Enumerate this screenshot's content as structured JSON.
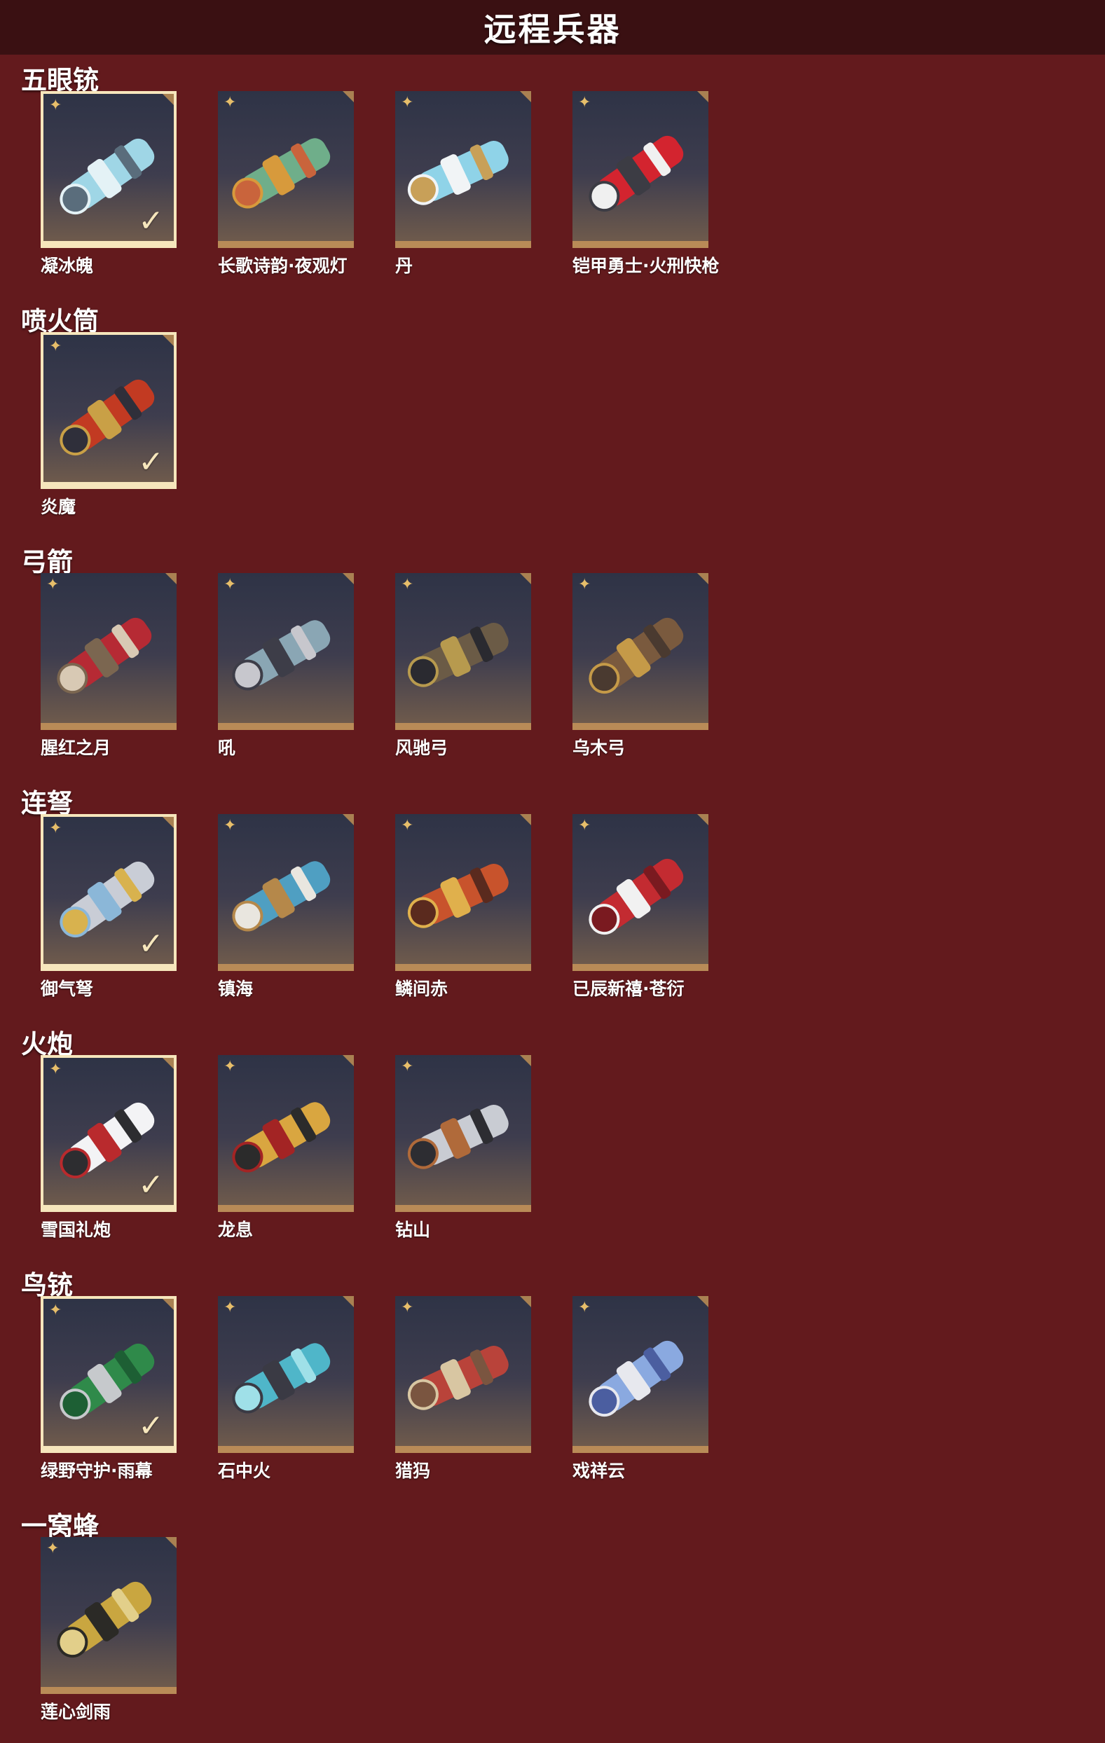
{
  "header": {
    "title": "远程兵器"
  },
  "icons": {
    "rarity": "four-point-star-icon",
    "selected": "checkmark-icon"
  },
  "colors": {
    "background": "#631a1d",
    "header": "#3a1012",
    "card_border": "#b98b57",
    "equipped_border": "#f6e6bc",
    "star": "#e7be6a"
  },
  "sections": [
    {
      "title": "五眼铳",
      "items": [
        {
          "name": "凝冰魄",
          "equipped": true,
          "palette": [
            "#9fd6e6",
            "#e4f2f6",
            "#5a6d7c"
          ]
        },
        {
          "name": "长歌诗韵·夜观灯",
          "equipped": false,
          "palette": [
            "#6fae8a",
            "#d79a3c",
            "#c9643c"
          ]
        },
        {
          "name": "丹",
          "equipped": false,
          "palette": [
            "#8fd3e8",
            "#f1f4f6",
            "#c8a058"
          ]
        },
        {
          "name": "铠甲勇士·火刑快枪",
          "equipped": false,
          "palette": [
            "#d3242f",
            "#3c3c44",
            "#f0f0f0"
          ]
        }
      ]
    },
    {
      "title": "喷火筒",
      "items": [
        {
          "name": "炎魔",
          "equipped": true,
          "palette": [
            "#c23a22",
            "#c9a046",
            "#2f2f3a"
          ]
        }
      ]
    },
    {
      "title": "弓箭",
      "items": [
        {
          "name": "腥红之月",
          "equipped": false,
          "palette": [
            "#b62a34",
            "#7b6650",
            "#d8c9b4"
          ]
        },
        {
          "name": "吼",
          "equipped": false,
          "palette": [
            "#8aa6b4",
            "#3d3d48",
            "#c7c7cd"
          ]
        },
        {
          "name": "风驰弓",
          "equipped": false,
          "palette": [
            "#6b5b46",
            "#b79a4e",
            "#2a2a30"
          ]
        },
        {
          "name": "乌木弓",
          "equipped": false,
          "palette": [
            "#7a5a3e",
            "#c59a48",
            "#4a3a30"
          ]
        }
      ]
    },
    {
      "title": "连弩",
      "items": [
        {
          "name": "御气弩",
          "equipped": true,
          "palette": [
            "#c9cdd6",
            "#8bb7d8",
            "#d8b24e"
          ]
        },
        {
          "name": "镇海",
          "equipped": false,
          "palette": [
            "#4f9fc2",
            "#b5884a",
            "#e9e6df"
          ]
        },
        {
          "name": "鳞间赤",
          "equipped": false,
          "palette": [
            "#c8532c",
            "#e0b04c",
            "#5a2a1e"
          ]
        },
        {
          "name": "已辰新禧·苍衍",
          "equipped": false,
          "palette": [
            "#c32b31",
            "#f1f1f1",
            "#7a1a20"
          ]
        }
      ]
    },
    {
      "title": "火炮",
      "items": [
        {
          "name": "雪国礼炮",
          "equipped": true,
          "palette": [
            "#f3f3f5",
            "#b92a2d",
            "#2d2d30"
          ]
        },
        {
          "name": "龙息",
          "equipped": false,
          "palette": [
            "#d9a640",
            "#a32424",
            "#2b2b2b"
          ]
        },
        {
          "name": "钻山",
          "equipped": false,
          "palette": [
            "#c9ccd3",
            "#b06a3a",
            "#2d2d32"
          ]
        }
      ]
    },
    {
      "title": "鸟铳",
      "items": [
        {
          "name": "绿野守护·雨幕",
          "equipped": true,
          "palette": [
            "#2f8a4a",
            "#c6c9cc",
            "#1d5f34"
          ]
        },
        {
          "name": "石中火",
          "equipped": false,
          "palette": [
            "#4fb6c9",
            "#3a3a44",
            "#9fe0e8"
          ]
        },
        {
          "name": "猎犸",
          "equipped": false,
          "palette": [
            "#b9433a",
            "#d8c6a2",
            "#7a5540"
          ]
        },
        {
          "name": "戏祥云",
          "equipped": false,
          "palette": [
            "#8aa9e0",
            "#e7e8ee",
            "#4b5ea0"
          ]
        }
      ]
    },
    {
      "title": "一窝蜂",
      "items": [
        {
          "name": "莲心剑雨",
          "equipped": false,
          "palette": [
            "#c9a640",
            "#2b2a26",
            "#e2cf8a"
          ]
        }
      ]
    }
  ]
}
